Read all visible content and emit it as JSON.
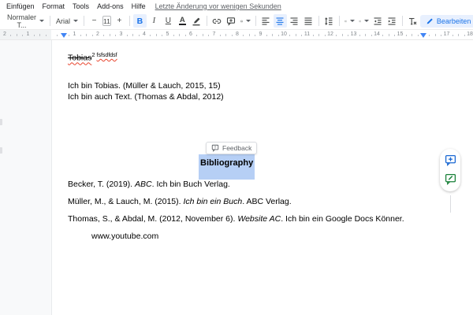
{
  "colors": {
    "accent_blue": "#1a73e8",
    "active_bg": "#e8f0fe",
    "selection_blue": "#b6cff5",
    "spellcheck_red": "#e8442d",
    "comment_blue": "#1967d2",
    "suggest_green": "#188038"
  },
  "menu": {
    "items": [
      {
        "id": "einfuegen",
        "label": "Einfügen"
      },
      {
        "id": "format",
        "label": "Format"
      },
      {
        "id": "tools",
        "label": "Tools"
      },
      {
        "id": "addons",
        "label": "Add-ons"
      },
      {
        "id": "hilfe",
        "label": "Hilfe"
      }
    ],
    "last_edit": "Letzte Änderung vor wenigen Sekunden"
  },
  "toolbar": {
    "style": "Normaler T...",
    "font": "Arial",
    "font_size": "11",
    "bold": "B",
    "italic": "I",
    "underline": "U",
    "text_color": "A",
    "edit_mode": "Bearbeiten"
  },
  "icons": {
    "minus": "−",
    "plus": "+"
  },
  "ruler": {
    "outside_numbers": [
      "2",
      "1"
    ],
    "numbers": [
      "1",
      "2",
      "3",
      "4",
      "5",
      "6",
      "7",
      "8",
      "9",
      "10",
      "11",
      "12",
      "13",
      "14",
      "15",
      "17",
      "18"
    ]
  },
  "doc": {
    "title": {
      "word": "Tobias",
      "sup": "2",
      "note": "fsfsdfdsf"
    },
    "paragraphs": [
      "Ich bin Tobias. (Müller & Lauch, 2015, 15)",
      "Ich bin auch Text. (Thomas & Abdal, 2012)"
    ],
    "feedback": "Feedback",
    "heading": "Bibliography",
    "references": [
      {
        "segments": [
          {
            "t": "Becker, T. (2019). "
          },
          {
            "t": "ABC",
            "i": true
          },
          {
            "t": ". Ich bin Buch Verlag."
          }
        ]
      },
      {
        "segments": [
          {
            "t": "Müller, M., & Lauch, M. (2015). "
          },
          {
            "t": "Ich bin ein Buch",
            "i": true
          },
          {
            "t": ". ABC Verlag."
          }
        ]
      },
      {
        "segments": [
          {
            "t": "Thomas, S., & Abdal, M. (2012, November 6). "
          },
          {
            "t": "Website AC",
            "i": true
          },
          {
            "t": ". Ich bin ein Google Docs Könner."
          }
        ]
      }
    ],
    "reference_continuation": "www.youtube.com"
  }
}
